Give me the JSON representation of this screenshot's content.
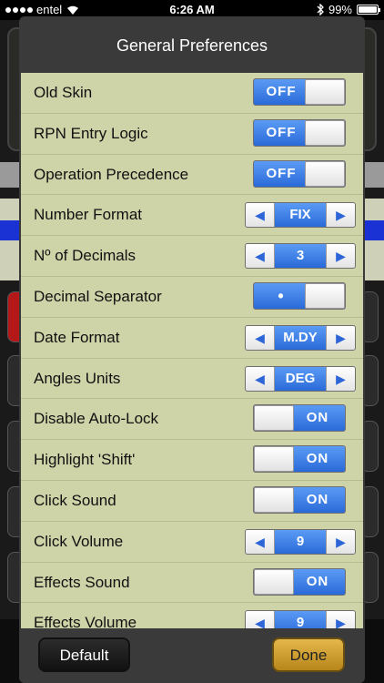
{
  "status_bar": {
    "carrier": "entel",
    "time": "6:26 AM",
    "battery": "99%",
    "battery_level": 0.99
  },
  "dialog": {
    "title": "General Preferences",
    "rows": [
      {
        "label": "Old Skin",
        "control": "toggle",
        "state": "off",
        "value": "OFF"
      },
      {
        "label": "RPN Entry Logic",
        "control": "toggle",
        "state": "off",
        "value": "OFF"
      },
      {
        "label": "Operation Precedence",
        "control": "toggle",
        "state": "off",
        "value": "OFF"
      },
      {
        "label": "Number Format",
        "control": "stepper",
        "value": "FIX"
      },
      {
        "label": "Nº of Decimals",
        "control": "stepper",
        "value": "3"
      },
      {
        "label": "Decimal Separator",
        "control": "toggle",
        "state": "off",
        "value": "•"
      },
      {
        "label": "Date Format",
        "control": "stepper",
        "value": "M.DY"
      },
      {
        "label": "Angles Units",
        "control": "stepper",
        "value": "DEG"
      },
      {
        "label": "Disable Auto-Lock",
        "control": "toggle",
        "state": "on",
        "value": "ON"
      },
      {
        "label": "Highlight 'Shift'",
        "control": "toggle",
        "state": "on",
        "value": "ON"
      },
      {
        "label": "Click Sound",
        "control": "toggle",
        "state": "on",
        "value": "ON"
      },
      {
        "label": "Click Volume",
        "control": "stepper",
        "value": "9"
      },
      {
        "label": "Effects Sound",
        "control": "toggle",
        "state": "on",
        "value": "ON"
      },
      {
        "label": "Effects Volume",
        "control": "stepper",
        "value": "9"
      }
    ],
    "stepper_left_glyph": "◀",
    "stepper_right_glyph": "▶",
    "default_button": "Default",
    "done_button": "Done"
  },
  "colors": {
    "list_background": "#cfd3a8",
    "toggle_blue": "#3d7fe6",
    "done_gold": "#d4a230",
    "dialog_frame": "#3a3a3a"
  },
  "icons": [
    "signal-dots-icon",
    "wifi-icon",
    "bluetooth-icon",
    "battery-icon"
  ]
}
